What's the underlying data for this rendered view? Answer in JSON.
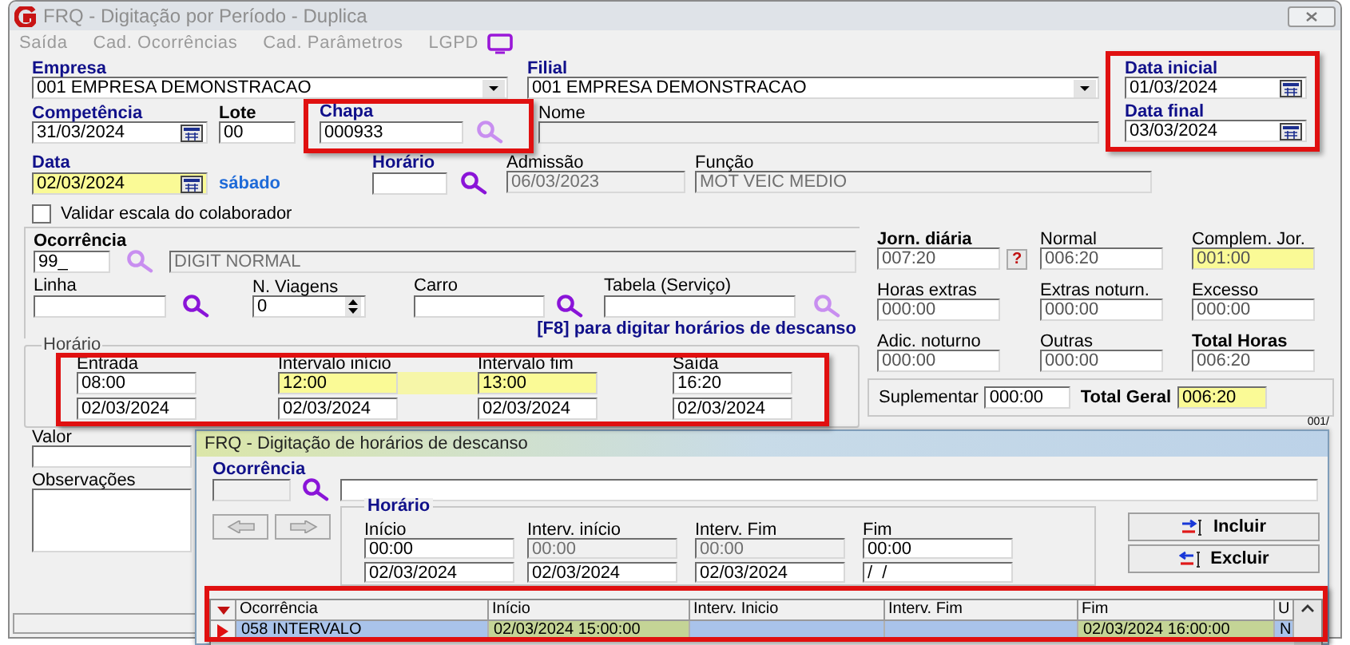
{
  "window": {
    "title": "FRQ - Digitação por Período - Duplica"
  },
  "menu": [
    "Saída",
    "Cad. Ocorrências",
    "Cad. Parâmetros",
    "LGPD"
  ],
  "empresa": {
    "label": "Empresa",
    "value": "001 EMPRESA DEMONSTRACAO"
  },
  "filial": {
    "label": "Filial",
    "value": "001 EMPRESA DEMONSTRACAO"
  },
  "data_inicial": {
    "label": "Data inicial",
    "value": "01/03/2024"
  },
  "data_final": {
    "label": "Data final",
    "value": "03/03/2024"
  },
  "competencia": {
    "label": "Competência",
    "value": "31/03/2024"
  },
  "lote": {
    "label": "Lote",
    "value": "00"
  },
  "chapa": {
    "label": "Chapa",
    "value": "000933"
  },
  "nome": {
    "label": "Nome",
    "disabled": true
  },
  "data": {
    "label": "Data",
    "value": "02/03/2024",
    "highlighted": true,
    "weekday": "sábado"
  },
  "horario": {
    "label": "Horário"
  },
  "admissao": {
    "label": "Admissão",
    "value": "06/03/2023",
    "disabled": true
  },
  "funcao": {
    "label": "Função",
    "value": "MOT VEIC MEDIO",
    "disabled": true
  },
  "validar_escala": {
    "label": "Validar escala do colaborador",
    "checked": false
  },
  "ocorrencia": {
    "label": "Ocorrência",
    "code": {
      "value": "99_"
    },
    "description": {
      "value": "DIGIT NORMAL",
      "disabled": true
    }
  },
  "linha": {
    "label": "Linha"
  },
  "n_viagens": {
    "label": "N. Viagens",
    "value": "0"
  },
  "carro": {
    "label": "Carro"
  },
  "tabela": {
    "label": "Tabela (Serviço)"
  },
  "f8_hint": "[F8] para digitar horários de descanso",
  "horario_group": {
    "title": "Horário",
    "columns": [
      {
        "label": "Entrada",
        "time": {
          "value": "08:00",
          "highlighted": false
        },
        "date": {
          "value": "02/03/2024"
        }
      },
      {
        "label": "Intervalo início",
        "time": {
          "value": "12:00",
          "highlighted": true
        },
        "date": {
          "value": "02/03/2024"
        }
      },
      {
        "label": "Intervalo fim",
        "time": {
          "value": "13:00",
          "highlighted": true
        },
        "date": {
          "value": "02/03/2024"
        }
      },
      {
        "label": "Saída",
        "time": {
          "value": "16:20",
          "highlighted": false
        },
        "date": {
          "value": "02/03/2024"
        }
      }
    ]
  },
  "totals": [
    {
      "label": "Jorn. diária",
      "value": "007:20",
      "bold": true,
      "highlighted": false,
      "help": "?"
    },
    {
      "label": "Normal",
      "value": "006:20",
      "bold": false,
      "highlighted": false
    },
    {
      "label": "Complem. Jor.",
      "value": "001:00",
      "bold": false,
      "highlighted": true
    },
    {
      "label": "Horas extras",
      "value": "000:00",
      "bold": false,
      "highlighted": false
    },
    {
      "label": "Extras noturn.",
      "value": "000:00",
      "bold": false,
      "highlighted": false
    },
    {
      "label": "Excesso",
      "value": "000:00",
      "bold": false,
      "highlighted": false
    },
    {
      "label": "Adic. noturno",
      "value": "000:00",
      "bold": false,
      "highlighted": false
    },
    {
      "label": "Outras",
      "value": "000:00",
      "bold": false,
      "highlighted": false
    },
    {
      "label": "Total Horas",
      "value": "006:20",
      "bold": true,
      "highlighted": false
    }
  ],
  "suplementar": {
    "label": "Suplementar",
    "value": "000:00"
  },
  "total_geral": {
    "label": "Total Geral",
    "value": "006:20",
    "highlighted": true
  },
  "valor": {
    "label": "Valor"
  },
  "observacoes": {
    "label": "Observações"
  },
  "edge_text": "001/",
  "dialog": {
    "title": "FRQ - Digitação de horários de descanso",
    "ocorrencia": {
      "label": "Ocorrência",
      "code": {
        "disabled": true
      }
    },
    "horario": {
      "title": "Horário",
      "columns": [
        {
          "label": "Início",
          "time": {
            "value": "00:00",
            "disabled": false
          },
          "date": {
            "value": "02/03/2024"
          }
        },
        {
          "label": "Interv. início",
          "time": {
            "value": "00:00",
            "disabled": true
          },
          "date": {
            "value": "02/03/2024"
          }
        },
        {
          "label": "Interv. Fim",
          "time": {
            "value": "00:00",
            "disabled": true
          },
          "date": {
            "value": "02/03/2024"
          }
        },
        {
          "label": "Fim",
          "time": {
            "value": "00:00",
            "disabled": false
          },
          "date": {
            "value": "/  /"
          }
        }
      ]
    },
    "buttons": [
      {
        "label": "Incluir",
        "kind": "add"
      },
      {
        "label": "Excluir",
        "kind": "remove"
      }
    ],
    "grid": {
      "columns": [
        "Ocorrência",
        "Início",
        "Interv. Inicio",
        "Interv. Fim",
        "Fim",
        "U"
      ],
      "rows": [
        {
          "selected": true,
          "cells": [
            {
              "text": "058 INTERVALO",
              "highlighted": false
            },
            {
              "text": "02/03/2024 15:00:00",
              "highlighted": true
            },
            null,
            null,
            {
              "text": "02/03/2024 16:00:00",
              "highlighted": true
            },
            {
              "text": "N",
              "highlighted": false
            }
          ]
        }
      ]
    }
  }
}
